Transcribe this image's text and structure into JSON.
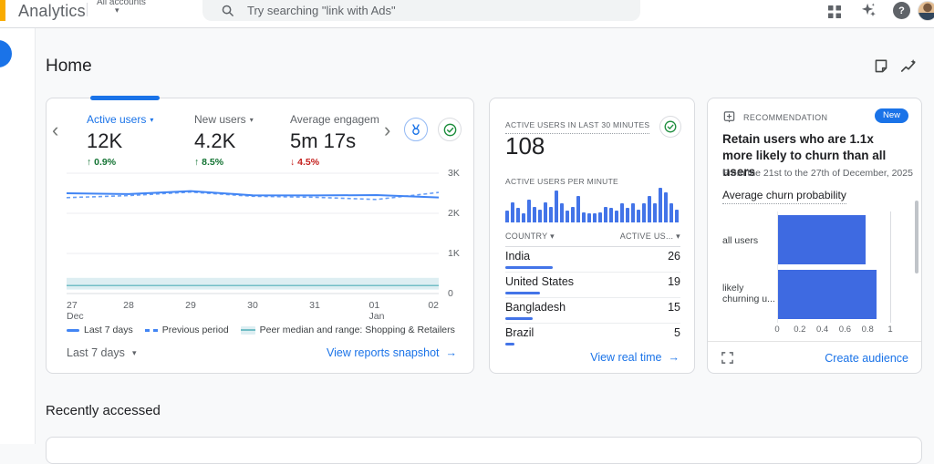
{
  "topbar": {
    "brand": "Analytics",
    "account_label": "All accounts",
    "search": {
      "placeholder": "Try searching \"link with Ads\""
    },
    "help_glyph": "?",
    "icons": [
      "apps-grid-icon",
      "gemini-sparkle-icon",
      "help-icon",
      "user-avatar"
    ]
  },
  "page": {
    "title": "Home",
    "recently_accessed": "Recently accessed"
  },
  "overview_card": {
    "metrics": [
      {
        "label": "Active users",
        "value": "12K",
        "delta": "0.9%",
        "direction": "up",
        "active": true
      },
      {
        "label": "New users",
        "value": "4.2K",
        "delta": "8.5%",
        "direction": "up",
        "active": false
      },
      {
        "label": "Average engagement",
        "value": "5m 17s",
        "delta": "4.5%",
        "direction": "down",
        "active": false
      }
    ],
    "chart_data": {
      "type": "line",
      "x_labels": [
        {
          "day": "27",
          "month": "Dec"
        },
        {
          "day": "28"
        },
        {
          "day": "29"
        },
        {
          "day": "30"
        },
        {
          "day": "31"
        },
        {
          "day": "01",
          "month": "Jan"
        },
        {
          "day": "02"
        }
      ],
      "ylim": [
        0,
        3000
      ],
      "yticks": [
        "3K",
        "2K",
        "1K",
        "0"
      ],
      "ytick_values": [
        3000,
        2000,
        1000,
        0
      ],
      "series": [
        {
          "name": "Last 7 days",
          "style": "solid",
          "color": "#4285f4",
          "values": [
            2500,
            2480,
            2555,
            2450,
            2445,
            2455,
            2395
          ]
        },
        {
          "name": "Previous period",
          "style": "dashed",
          "color": "#669df6",
          "values": [
            2390,
            2440,
            2530,
            2425,
            2400,
            2345,
            2520
          ]
        },
        {
          "name": "Peer median and range: Shopping & Retailers",
          "style": "band",
          "color": "#ddeef2",
          "line_color": "#72bec6",
          "median": 200,
          "range_low": 100,
          "range_high": 390
        }
      ]
    },
    "legend": [
      "Last 7 days",
      "Previous period",
      "Peer median and range: Shopping & Retailers"
    ],
    "date_range_label": "Last 7 days",
    "footer_link": "View reports snapshot"
  },
  "realtime_card": {
    "title": "ACTIVE USERS IN LAST 30 MINUTES",
    "value": "108",
    "per_minute_label": "ACTIVE USERS PER MINUTE",
    "chart_data": {
      "type": "bar",
      "values": [
        8,
        14,
        10,
        6,
        16,
        11,
        9,
        14,
        11,
        22,
        13,
        8,
        11,
        18,
        7,
        6,
        6,
        7,
        11,
        10,
        8,
        13,
        10,
        13,
        9,
        13,
        18,
        13,
        24,
        21,
        13,
        9
      ],
      "color": "#4374e8"
    },
    "table": {
      "col_country": "COUNTRY",
      "col_users": "ACTIVE US...",
      "rows": [
        {
          "country": "India",
          "value": 26
        },
        {
          "country": "United States",
          "value": 19
        },
        {
          "country": "Bangladesh",
          "value": 15
        },
        {
          "country": "Brazil",
          "value": 5
        }
      ]
    },
    "footer_link": "View real time"
  },
  "recommendation_card": {
    "eyebrow": "RECOMMENDATION",
    "badge": "New",
    "title": "Retain users who are 1.1x more likely to churn than all users",
    "subtitle": "From the 21st to the 27th of December, 2025",
    "chart_title": "Average churn probability",
    "chart_data": {
      "type": "bar",
      "orientation": "horizontal",
      "categories": [
        "all users",
        "likely churning u..."
      ],
      "values": [
        0.78,
        0.88
      ],
      "xlim": [
        0,
        1
      ],
      "ticks": [
        "0",
        "0.2",
        "0.4",
        "0.6",
        "0.8",
        "1"
      ],
      "color": "#3e6ae1"
    },
    "footer_link": "Create audience"
  }
}
